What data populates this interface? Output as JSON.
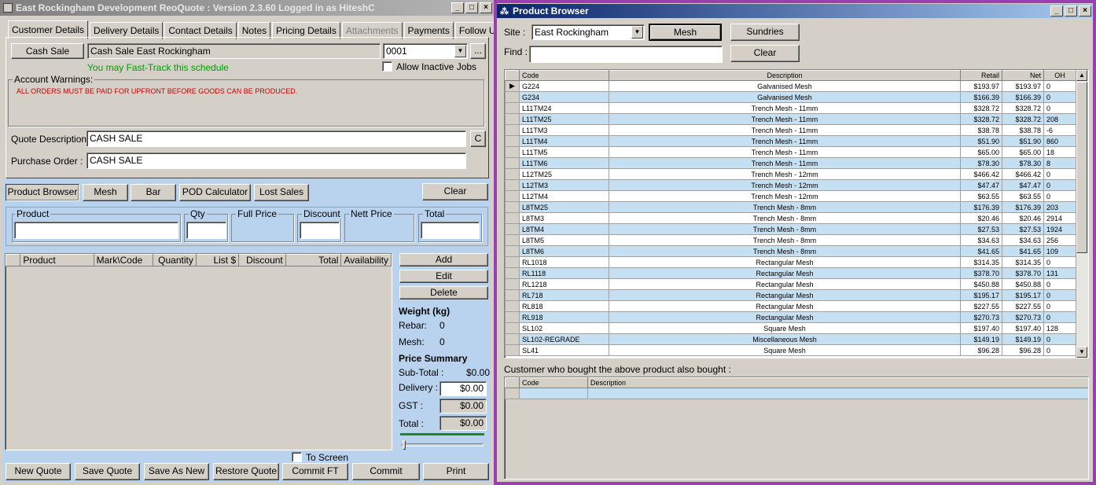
{
  "left_window": {
    "title": "East Rockingham Development ReoQuote : Version 2.3.60 Logged in as HiteshC",
    "tabs": [
      "Customer Details",
      "Delivery Details",
      "Contact Details",
      "Notes",
      "Pricing Details",
      "Attachments",
      "Payments",
      "Follow Ups"
    ],
    "cash_sale_button": "Cash Sale",
    "customer_name": "Cash Sale East Rockingham",
    "job_number": "0001",
    "ellipsis_button": "...",
    "fast_track_text": "You may Fast-Track this schedule",
    "allow_inactive_label": "Allow Inactive Jobs",
    "account_warnings_label": "Account Warnings:",
    "account_warning_text": "ALL ORDERS MUST BE PAID FOR UPFRONT BEFORE GOODS CAN BE PRODUCED.",
    "quote_description_label": "Quote Description :",
    "quote_description_value": "CASH SALE",
    "c_button": "C",
    "purchase_order_label": "Purchase Order :",
    "purchase_order_value": "CASH SALE",
    "toolbar": {
      "product_browser": "Product Browser",
      "mesh": "Mesh",
      "bar": "Bar",
      "pod_calculator": "POD Calculator",
      "lost_sales": "Lost Sales",
      "clear": "Clear"
    },
    "entry": {
      "product": "Product",
      "qty": "Qty",
      "full_price": "Full Price",
      "discount": "Discount",
      "nett_price": "Nett Price",
      "total": "Total"
    },
    "lines_columns": [
      "Product",
      "Mark\\Code",
      "Quantity",
      "List $",
      "Discount",
      "Total",
      "Availability"
    ],
    "actions": {
      "add": "Add",
      "edit": "Edit",
      "delete": "Delete"
    },
    "weight": {
      "title": "Weight (kg)",
      "rebar_label": "Rebar:",
      "rebar_value": "0",
      "mesh_label": "Mesh:",
      "mesh_value": "0"
    },
    "price_summary": {
      "title": "Price Summary",
      "subtotal_label": "Sub-Total :",
      "subtotal_value": "$0.00",
      "delivery_label": "Delivery :",
      "delivery_value": "$0.00",
      "gst_label": "GST :",
      "gst_value": "$0.00",
      "total_label": "Total :",
      "total_value": "$0.00"
    },
    "to_screen_label": "To Screen",
    "bottom_buttons": {
      "new_quote": "New Quote",
      "save_quote": "Save Quote",
      "save_as_new": "Save As New",
      "restore_quote": "Restore Quote",
      "commit_ft": "Commit FT",
      "commit": "Commit",
      "print": "Print"
    }
  },
  "product_browser": {
    "title": "Product Browser",
    "site_label": "Site :",
    "site_value": "East Rockingham",
    "mesh_button": "Mesh",
    "sundries_button": "Sundries",
    "find_label": "Find :",
    "find_value": "",
    "clear_button": "Clear",
    "columns": [
      "Code",
      "Description",
      "Retail",
      "Net",
      "OH"
    ],
    "rows": [
      [
        "G224",
        "Galvanised Mesh",
        "$193.97",
        "$193.97",
        "0"
      ],
      [
        "G234",
        "Galvanised Mesh",
        "$166.39",
        "$166.39",
        "0"
      ],
      [
        "L11TM24",
        "Trench Mesh - 11mm",
        "$328.72",
        "$328.72",
        "0"
      ],
      [
        "L11TM25",
        "Trench Mesh - 11mm",
        "$328.72",
        "$328.72",
        "208"
      ],
      [
        "L11TM3",
        "Trench Mesh - 11mm",
        "$38.78",
        "$38.78",
        "-6"
      ],
      [
        "L11TM4",
        "Trench Mesh - 11mm",
        "$51.90",
        "$51.90",
        "860"
      ],
      [
        "L11TM5",
        "Trench Mesh - 11mm",
        "$65.00",
        "$65.00",
        "18"
      ],
      [
        "L11TM6",
        "Trench Mesh - 11mm",
        "$78.30",
        "$78.30",
        "8"
      ],
      [
        "L12TM25",
        "Trench Mesh - 12mm",
        "$466.42",
        "$466.42",
        "0"
      ],
      [
        "L12TM3",
        "Trench Mesh - 12mm",
        "$47.47",
        "$47.47",
        "0"
      ],
      [
        "L12TM4",
        "Trench Mesh - 12mm",
        "$63.55",
        "$63.55",
        "0"
      ],
      [
        "L8TM25",
        "Trench Mesh - 8mm",
        "$176.39",
        "$176.39",
        "203"
      ],
      [
        "L8TM3",
        "Trench Mesh - 8mm",
        "$20.46",
        "$20.46",
        "2914"
      ],
      [
        "L8TM4",
        "Trench Mesh - 8mm",
        "$27.53",
        "$27.53",
        "1924"
      ],
      [
        "L8TM5",
        "Trench Mesh - 8mm",
        "$34.63",
        "$34.63",
        "256"
      ],
      [
        "L8TM6",
        "Trench Mesh - 8mm",
        "$41.65",
        "$41.65",
        "109"
      ],
      [
        "RL1018",
        "Rectangular Mesh",
        "$314.35",
        "$314.35",
        "0"
      ],
      [
        "RL1118",
        "Rectangular Mesh",
        "$378.70",
        "$378.70",
        "131"
      ],
      [
        "RL1218",
        "Rectangular Mesh",
        "$450.88",
        "$450.88",
        "0"
      ],
      [
        "RL718",
        "Rectangular Mesh",
        "$195.17",
        "$195.17",
        "0"
      ],
      [
        "RL818",
        "Rectangular Mesh",
        "$227.55",
        "$227.55",
        "0"
      ],
      [
        "RL918",
        "Rectangular Mesh",
        "$270.73",
        "$270.73",
        "0"
      ],
      [
        "SL102",
        "Square Mesh",
        "$197.40",
        "$197.40",
        "128"
      ],
      [
        "SL102-REGRADE",
        "Miscellaneous Mesh",
        "$149.19",
        "$149.19",
        "0"
      ],
      [
        "SL41",
        "Square Mesh",
        "$96.28",
        "$96.28",
        "0"
      ]
    ],
    "also_bought_label": "Customer who bought the above product also bought :",
    "also_bought_columns": [
      "Code",
      "Description"
    ]
  },
  "colors": {
    "window_bg": "#d4d0c8",
    "blue_panel": "#b9d3ee",
    "row_alt": "#c5dff3",
    "warning_red": "#cc0000",
    "fast_track_green": "#00a000",
    "active_title": "#0a246a",
    "border_purple": "#9b3fb0"
  }
}
